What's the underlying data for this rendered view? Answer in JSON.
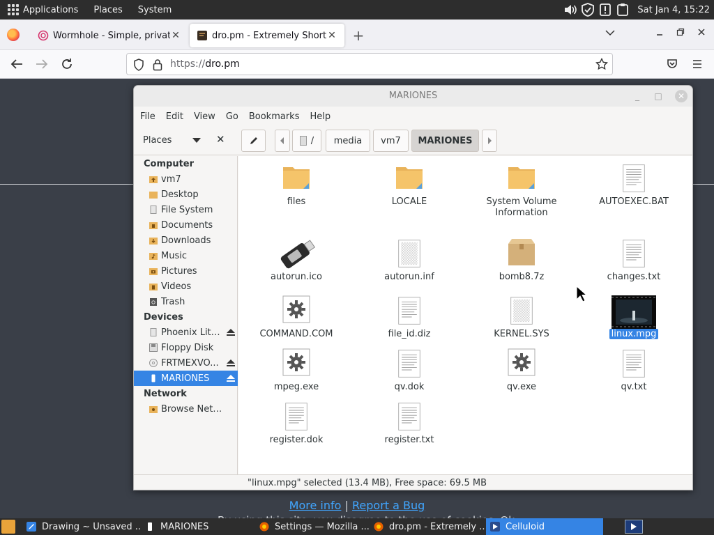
{
  "panel": {
    "menus": [
      "Applications",
      "Places",
      "System"
    ],
    "clock": "Sat Jan  4, 15:22"
  },
  "browser": {
    "tabs": [
      {
        "title": "Wormhole - Simple, private",
        "active": false
      },
      {
        "title": "dro.pm - Extremely Short Li",
        "active": true
      }
    ],
    "url_scheme": "https://",
    "url_host": "dro.pm"
  },
  "page": {
    "more_info": "More info",
    "separator": "|",
    "report_bug": "Report a Bug",
    "cookie_text": "By using this site, you disagree to the use of cookies. Ok"
  },
  "file_manager": {
    "title": "MARIONES",
    "menu": [
      "File",
      "Edit",
      "View",
      "Go",
      "Bookmarks",
      "Help"
    ],
    "places_label": "Places",
    "path": [
      "/",
      "media",
      "vm7",
      "MARIONES"
    ],
    "sidebar": {
      "computer_heading": "Computer",
      "computer": [
        "vm7",
        "Desktop",
        "File System",
        "Documents",
        "Downloads",
        "Music",
        "Pictures",
        "Videos",
        "Trash"
      ],
      "devices_heading": "Devices",
      "devices": [
        "Phoenix Lite...",
        "Floppy Disk",
        "FRTMEXVO...",
        "MARIONES"
      ],
      "network_heading": "Network",
      "network": [
        "Browse Network"
      ]
    },
    "items": [
      {
        "name": "files",
        "type": "folder"
      },
      {
        "name": "LOCALE",
        "type": "folder"
      },
      {
        "name": "System Volume\nInformation",
        "type": "folder"
      },
      {
        "name": "AUTOEXEC.BAT",
        "type": "text"
      },
      {
        "name": "autorun.ico",
        "type": "usb"
      },
      {
        "name": "autorun.inf",
        "type": "blank"
      },
      {
        "name": "bomb8.7z",
        "type": "archive"
      },
      {
        "name": "changes.txt",
        "type": "text"
      },
      {
        "name": "COMMAND.COM",
        "type": "exec"
      },
      {
        "name": "file_id.diz",
        "type": "text"
      },
      {
        "name": "KERNEL.SYS",
        "type": "blank"
      },
      {
        "name": "linux.mpg",
        "type": "video",
        "selected": true
      },
      {
        "name": "mpeg.exe",
        "type": "exec"
      },
      {
        "name": "qv.dok",
        "type": "text"
      },
      {
        "name": "qv.exe",
        "type": "exec"
      },
      {
        "name": "qv.txt",
        "type": "text"
      },
      {
        "name": "register.dok",
        "type": "text"
      },
      {
        "name": "register.txt",
        "type": "text"
      }
    ],
    "status": "\"linux.mpg\" selected (13.4 MB), Free space: 69.5 MB"
  },
  "taskbar": {
    "tasks": [
      {
        "label": "Drawing ~ Unsaved ...",
        "active": false
      },
      {
        "label": "MARIONES",
        "active": false
      },
      {
        "label": "Settings — Mozilla ...",
        "active": false
      },
      {
        "label": "dro.pm - Extremely ...",
        "active": false
      },
      {
        "label": "Celluloid",
        "active": true
      }
    ]
  }
}
